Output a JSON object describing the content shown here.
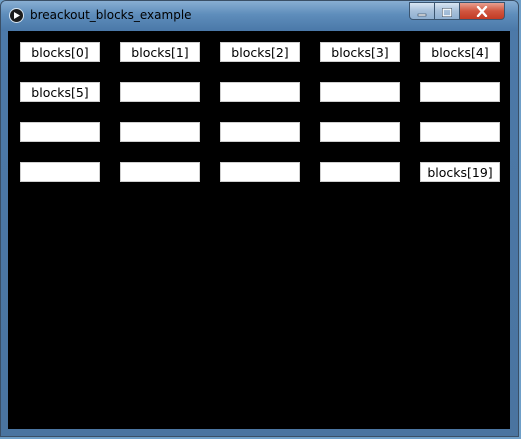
{
  "window": {
    "title": "breackout_blocks_example",
    "controls": {
      "minimize_icon": "minimize-icon",
      "maximize_icon": "maximize-icon",
      "close_icon": "close-icon"
    }
  },
  "colors": {
    "canvas_background": "#000000",
    "block_fill": "#ffffff",
    "block_text": "#000000"
  },
  "grid": {
    "columns": 5,
    "rows": 4
  },
  "blocks": [
    {
      "label": "blocks[0]"
    },
    {
      "label": "blocks[1]"
    },
    {
      "label": "blocks[2]"
    },
    {
      "label": "blocks[3]"
    },
    {
      "label": "blocks[4]"
    },
    {
      "label": "blocks[5]"
    },
    {
      "label": ""
    },
    {
      "label": ""
    },
    {
      "label": ""
    },
    {
      "label": ""
    },
    {
      "label": ""
    },
    {
      "label": ""
    },
    {
      "label": ""
    },
    {
      "label": ""
    },
    {
      "label": ""
    },
    {
      "label": ""
    },
    {
      "label": ""
    },
    {
      "label": ""
    },
    {
      "label": ""
    },
    {
      "label": "blocks[19]"
    }
  ]
}
